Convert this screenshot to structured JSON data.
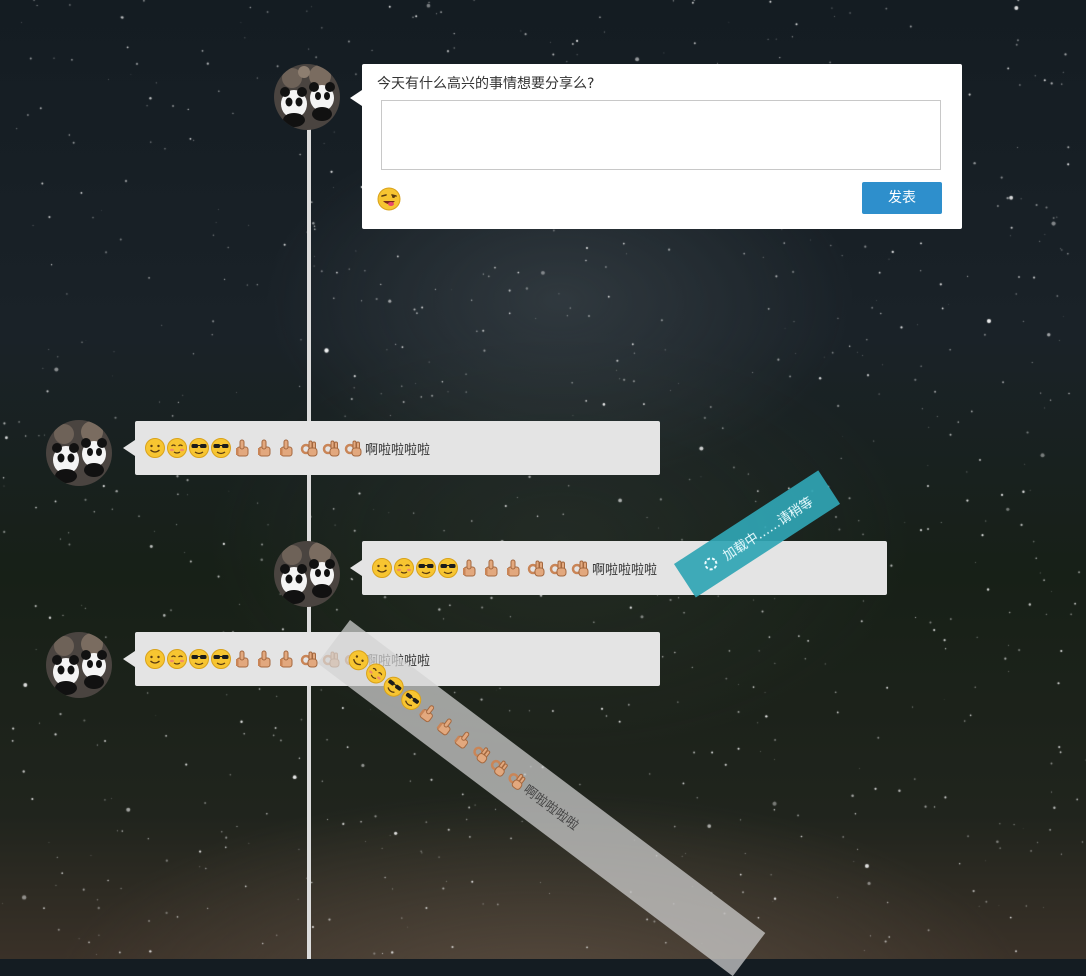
{
  "composer": {
    "prompt": "今天有什么高兴的事情想要分享么?",
    "textarea_value": "",
    "emoji_icon": "smiley-icon",
    "publish_label": "发表"
  },
  "posts": [
    {
      "side": "left",
      "text": "啊啦啦啦啦",
      "emojis": [
        "smile",
        "blush",
        "cool-sunglasses",
        "cool-sunglasses",
        "thumbs-up",
        "thumbs-up",
        "thumbs-up",
        "ok-hand",
        "ok-hand",
        "ok-hand"
      ]
    },
    {
      "side": "right",
      "text": "啊啦啦啦啦",
      "emojis": [
        "smile",
        "blush",
        "cool-sunglasses",
        "cool-sunglasses",
        "thumbs-up",
        "thumbs-up",
        "thumbs-up",
        "ok-hand",
        "ok-hand",
        "ok-hand"
      ]
    },
    {
      "side": "left",
      "text": "啊啦啦啦啦",
      "emojis": [
        "smile",
        "blush",
        "cool-sunglasses",
        "cool-sunglasses",
        "thumbs-up",
        "thumbs-up",
        "thumbs-up",
        "ok-hand",
        "ok-hand",
        "ok-hand"
      ]
    }
  ],
  "falling_post": {
    "text": "啊啦啦啦啦"
  },
  "loading": {
    "text": "加载中……请稍等"
  },
  "colors": {
    "publish_button": "#2e8fcc",
    "loading_badge": "#30a5b4",
    "bubble": "#e4e4e4",
    "timeline": "#dcdcdc"
  }
}
